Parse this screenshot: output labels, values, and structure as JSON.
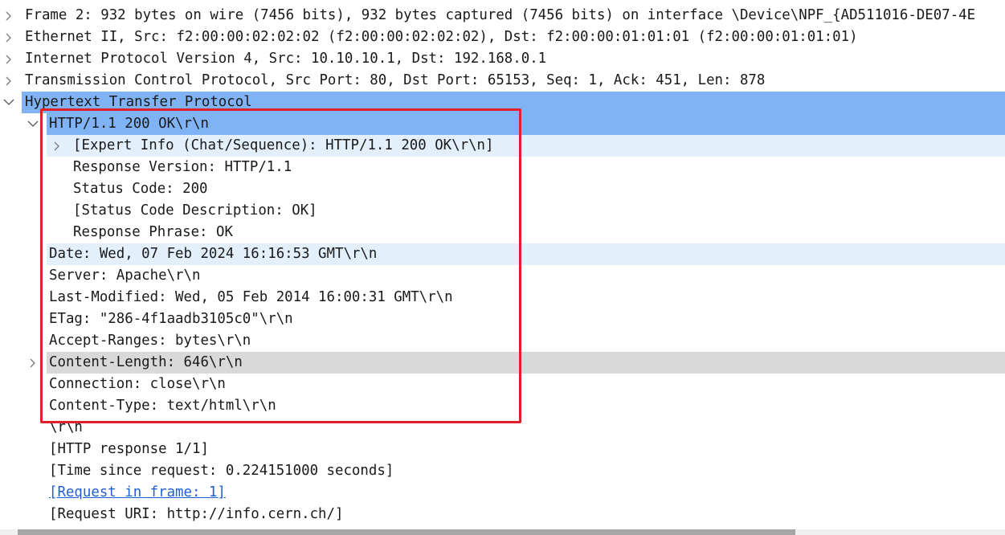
{
  "packet_details": {
    "rows": [
      {
        "text": "Frame 2: 932 bytes on wire (7456 bits), 932 bytes captured (7456 bits) on interface \\Device\\NPF_{AD511016-DE07-4E"
      },
      {
        "text": "Ethernet II, Src: f2:00:00:02:02:02 (f2:00:00:02:02:02), Dst: f2:00:00:01:01:01 (f2:00:00:01:01:01)"
      },
      {
        "text": "Internet Protocol Version 4, Src: 10.10.10.1, Dst: 192.168.0.1"
      },
      {
        "text": "Transmission Control Protocol, Src Port: 80, Dst Port: 65153, Seq: 1, Ack: 451, Len: 878"
      },
      {
        "text": "Hypertext Transfer Protocol"
      },
      {
        "text": "HTTP/1.1 200 OK\\r\\n"
      },
      {
        "text": "[Expert Info (Chat/Sequence): HTTP/1.1 200 OK\\r\\n]"
      },
      {
        "text": "Response Version: HTTP/1.1"
      },
      {
        "text": "Status Code: 200"
      },
      {
        "text": "[Status Code Description: OK]"
      },
      {
        "text": "Response Phrase: OK"
      },
      {
        "text": "Date: Wed, 07 Feb 2024 16:16:53 GMT\\r\\n"
      },
      {
        "text": "Server: Apache\\r\\n"
      },
      {
        "text": "Last-Modified: Wed, 05 Feb 2014 16:00:31 GMT\\r\\n"
      },
      {
        "text": "ETag: \"286-4f1aadb3105c0\"\\r\\n"
      },
      {
        "text": "Accept-Ranges: bytes\\r\\n"
      },
      {
        "text": "Content-Length: 646\\r\\n"
      },
      {
        "text": "Connection: close\\r\\n"
      },
      {
        "text": "Content-Type: text/html\\r\\n"
      },
      {
        "text": "\\r\\n"
      },
      {
        "text": "[HTTP response 1/1]"
      },
      {
        "text": "[Time since request: 0.224151000 seconds]"
      },
      {
        "text": "[Request in frame: 1]"
      },
      {
        "text": "[Request URI: http://info.cern.ch/]"
      }
    ]
  },
  "colors": {
    "selected_row": "#7fb3f5",
    "related_row": "#e3effb",
    "hover_row": "#d9d9d9",
    "annotation_box": "#e0202a",
    "link": "#1f5fd6"
  },
  "icons": {
    "collapsed": "chevron-right-icon",
    "expanded": "chevron-down-icon"
  }
}
